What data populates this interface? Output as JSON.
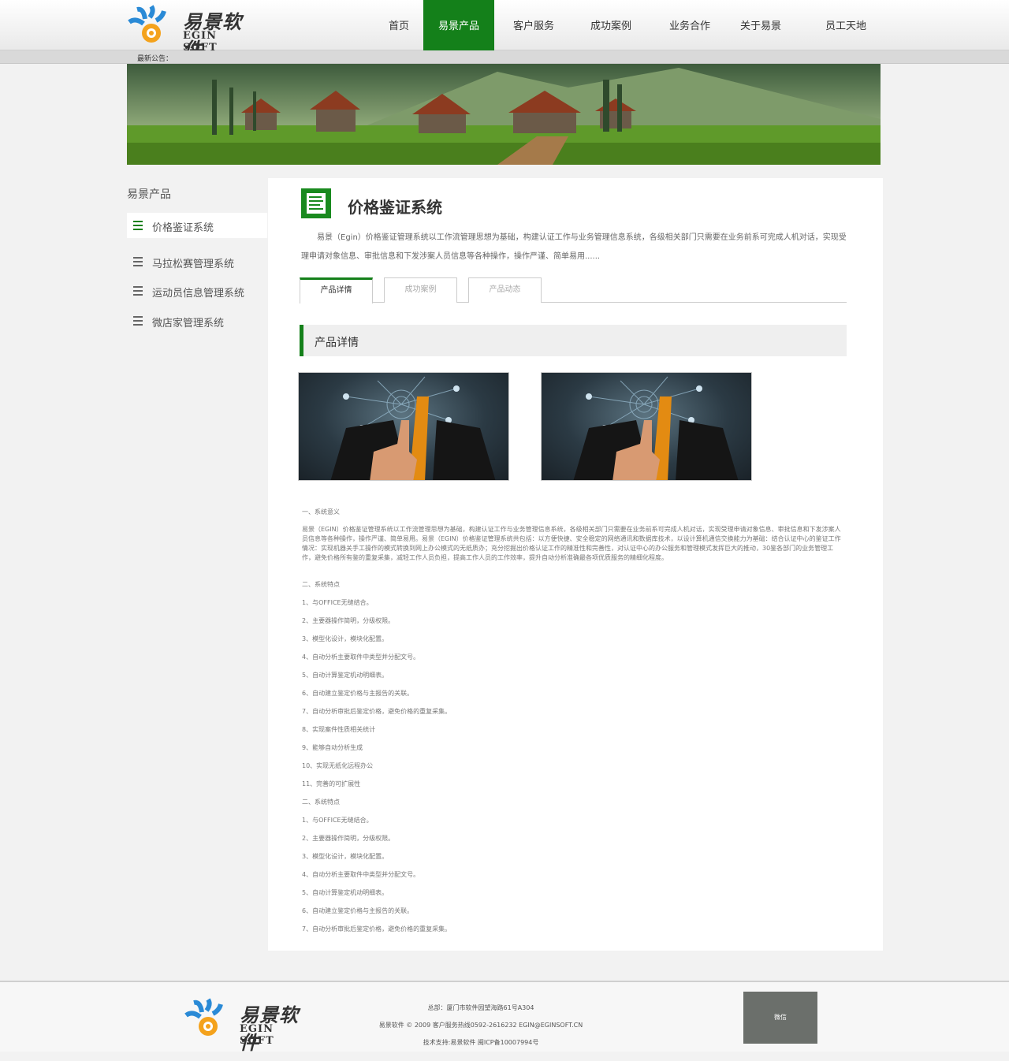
{
  "header": {
    "logo_cn": "易景软件",
    "logo_en": "EGIN SOFT",
    "nav": [
      {
        "label": "首页"
      },
      {
        "label": "易景产品"
      },
      {
        "label": "客户服务"
      },
      {
        "label": "成功案例"
      },
      {
        "label": "业务合作"
      },
      {
        "label": "关于易景"
      },
      {
        "label": "员工天地"
      }
    ],
    "active_nav": "易景产品"
  },
  "notice": {
    "label": "最新公告："
  },
  "sidebar": {
    "title": "易景产品",
    "items": [
      {
        "label": "价格鉴证系统"
      },
      {
        "label": "马拉松赛管理系统"
      },
      {
        "label": "运动员信息管理系统"
      },
      {
        "label": "微店家管理系统"
      }
    ]
  },
  "main": {
    "title": "价格鉴证系统",
    "intro": "易景（Egin）价格鉴证管理系统以工作流管理思想为基础，构建认证工作与业务管理信息系统，各级相关部门只需要在业务前系可完成人机对话，实现受理申请对象信息、审批信息和下发涉案人员信息等各种操作，操作严谨、简单易用......",
    "tabs": [
      {
        "label": "产品详情"
      },
      {
        "label": "成功案例"
      },
      {
        "label": "产品动态"
      }
    ],
    "section_title": "产品详情",
    "body": {
      "h1": "一、系统意义",
      "p1": "易景（EGIN）价格鉴证管理系统以工作流管理思想为基础，构建认证工作与业务管理信息系统，各级相关部门只需要在业务前系可完成人机对话，实现受理申请对象信息、审批信息和下发涉案人员信息等各种操作，操作严谨、简单易用。易景（EGIN）价格鉴证管理系统共包括：以方便快捷、安全稳定的网络通讯和数据库技术，以设计算机通信交换能力为基础：结合认证中心的鉴证工作情况：实现机器关手工操作的模式转换到网上办公模式的无纸质办；充分挖掘出价格认证工作的精准性和完善性，对认证中心的办公服务和管理模式发挥巨大的推动，30鉴各部门的业务管理工作，避免价格所有鉴的重复采集，减轻工作人员负担，提高工作人员的工作效率，提升自动分析准确最各项优质服务的精细化程度。",
      "h2": "二、系统特点",
      "list1": [
        "1、与OFFICE无缝结合。",
        "2、主要器操作简明，分级权限。",
        "3、模型化设计，模块化配置。",
        "4、自动分析主要取件中类型并分配文号。",
        "5、自动计算鉴定机动明细表。",
        "6、自动建立鉴定价格与主报告的关联。",
        "7、自动分析审批后鉴定价格，避免价格的重复采集。",
        "8、实现案件性质相关统计",
        "9、能够自动分析生成",
        "10、实现无纸化远程办公",
        "11、完善的可扩展性"
      ],
      "h3": "二、系统特点",
      "list2": [
        "1、与OFFICE无缝结合。",
        "2、主要器操作简明，分级权限。",
        "3、模型化设计，模块化配置。",
        "4、自动分析主要取件中类型并分配文号。",
        "5、自动计算鉴定机动明细表。",
        "6、自动建立鉴定价格与主报告的关联。",
        "7、自动分析审批后鉴定价格，避免价格的重复采集。"
      ]
    }
  },
  "footer": {
    "logo_cn": "易景软件",
    "logo_en": "EGIN SOFT",
    "address": "总部：厦门市软件园望海路61号A304",
    "contact": "易景软件 © 2009 客户服务热线0592-2616232 EGIN@EGINSOFT.CN",
    "icp": "技术支持:易景软件 闽ICP备10007994号",
    "wechat": "微信"
  },
  "colors": {
    "brand_green": "#14801a"
  }
}
